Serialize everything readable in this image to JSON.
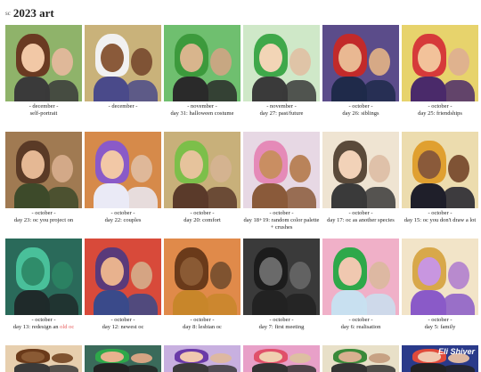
{
  "page": {
    "title": "2023 art",
    "header_mark": "sc"
  },
  "rows": [
    [
      {
        "label_top": "- december -",
        "label_bottom": "self-portrait",
        "bg": "#8fb36a",
        "hair": "#6a3a22",
        "skin": "#f2c8a6",
        "shirt": "#3a3a3a"
      },
      {
        "label_top": "- december -",
        "label_bottom": "",
        "bg": "#c9b27a",
        "hair": "#f1f1f1",
        "skin": "#8a5a3a",
        "shirt": "#4a4a8a"
      },
      {
        "label_top": "- november -",
        "label_bottom": "day 31: halloween costume",
        "bg": "#6fbf6f",
        "hair": "#3c9a3c",
        "skin": "#d8b58d",
        "shirt": "#2a2a2a"
      },
      {
        "label_top": "- november -",
        "label_bottom": "day 27: past/future",
        "bg": "#cfe8c8",
        "hair": "#3fa84a",
        "skin": "#f2d5b6",
        "shirt": "#3a3a3a"
      },
      {
        "label_top": "- october -",
        "label_bottom": "day 26: siblings",
        "bg": "#5b4c8a",
        "hair": "#c22a2a",
        "skin": "#e9b892",
        "shirt": "#1f2a4a"
      },
      {
        "label_top": "- october -",
        "label_bottom": "day 25: friendships",
        "bg": "#e7d36c",
        "hair": "#d63a3a",
        "skin": "#f2c29a",
        "shirt": "#4a2a6a"
      }
    ],
    [
      {
        "label_top": "- october -",
        "label_bottom": "day 23: oc you project on",
        "bg": "#a07a52",
        "hair": "#5a3a26",
        "skin": "#e5b894",
        "shirt": "#3d4a2a"
      },
      {
        "label_top": "- october -",
        "label_bottom": "day 22: couples",
        "bg": "#d68a4a",
        "hair": "#8a5ac8",
        "skin": "#f2c8a6",
        "shirt": "#eaeaf6"
      },
      {
        "label_top": "- october -",
        "label_bottom": "day 20: comfort",
        "bg": "#c8b07a",
        "hair": "#7cbf4a",
        "skin": "#e6c39c",
        "shirt": "#5a3a2a"
      },
      {
        "label_top": "- october -",
        "label_bottom": "day 18+19: random color palette + crushes",
        "bg": "#e7d8e4",
        "hair": "#e58ab8",
        "skin": "#c98e62",
        "shirt": "#8a5a3a"
      },
      {
        "label_top": "- october -",
        "label_bottom": "day 17: oc as another species",
        "bg": "#efe4d2",
        "hair": "#5a4a3a",
        "skin": "#f2d2b8",
        "shirt": "#3a3a3a"
      },
      {
        "label_top": "- october -",
        "label_bottom": "day 15: oc you don't draw a lot",
        "bg": "#ecdcae",
        "hair": "#e0a030",
        "skin": "#8a5a3a",
        "shirt": "#1f1f2a"
      }
    ],
    [
      {
        "label_top": "- october -",
        "label_bottom_prefix": "day 13: redesign an ",
        "label_bottom_highlight": "old oc",
        "bg": "#2a6a5a",
        "hair": "#49c09a",
        "skin": "#2f8c6a",
        "shirt": "#1f2a2a"
      },
      {
        "label_top": "- october -",
        "label_bottom": "day 12: newest oc",
        "bg": "#d84a3a",
        "hair": "#5a3a7a",
        "skin": "#e8b28e",
        "shirt": "#3a4a8a"
      },
      {
        "label_top": "- october -",
        "label_bottom": "day 8: lesbian oc",
        "bg": "#e08a4a",
        "hair": "#6a3a1a",
        "skin": "#8a5a34",
        "shirt": "#c8862a"
      },
      {
        "label_top": "- october -",
        "label_bottom": "day 7: first meeting",
        "bg": "#3a3a3a",
        "hair": "#1c1c1c",
        "skin": "#6a6a6a",
        "shirt": "#222222"
      },
      {
        "label_top": "- october -",
        "label_bottom": "day 6: realisation",
        "bg": "#f0b0c8",
        "hair": "#2ea84a",
        "skin": "#f0c8b0",
        "shirt": "#c8e0f0"
      },
      {
        "label_top": "- october -",
        "label_bottom": "day 5: family",
        "bg": "#f2e4c8",
        "hair": "#d8a84a",
        "skin": "#c896e0",
        "shirt": "#8a5ac8"
      }
    ],
    [
      {
        "bg": "#e7cfae",
        "hair": "#6a3a1a",
        "skin": "#8a5a34",
        "shirt": "#3a3a3a"
      },
      {
        "bg": "#3a6a5a",
        "hair": "#2ea84a",
        "skin": "#e8b28e",
        "shirt": "#222"
      },
      {
        "bg": "#c8b0e0",
        "hair": "#6a3aa8",
        "skin": "#f0c8b0",
        "shirt": "#3a3a3a"
      },
      {
        "bg": "#e8a0c8",
        "hair": "#e0506a",
        "skin": "#f0d0b0",
        "shirt": "#333"
      },
      {
        "bg": "#e8e0c8",
        "hair": "#3a8a3a",
        "skin": "#d8b090",
        "shirt": "#333"
      },
      {
        "bg": "#2a3a8a",
        "hair": "#e04a3a",
        "skin": "#f0c8b0",
        "shirt": "#222",
        "label_banner": "Eli Shiver"
      }
    ]
  ]
}
